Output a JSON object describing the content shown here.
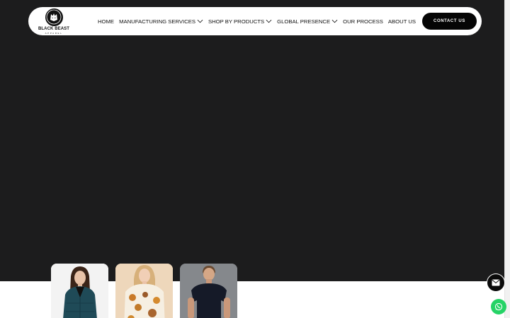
{
  "brand": {
    "name": "BLACK BEAST",
    "tagline": "APPAREL"
  },
  "nav": {
    "items": [
      {
        "label": "HOME",
        "has_dropdown": false
      },
      {
        "label": "MANUFACTURING SERVICES",
        "has_dropdown": true
      },
      {
        "label": "SHOP BY PRODUCTS",
        "has_dropdown": true
      },
      {
        "label": "GLOBAL PRESENCE",
        "has_dropdown": true
      },
      {
        "label": "OUR PROCESS",
        "has_dropdown": false
      },
      {
        "label": "ABOUT US",
        "has_dropdown": false
      }
    ],
    "contact_label": "CONTACT US"
  },
  "colors": {
    "hero_bg": "#1c1c1d",
    "button_bg": "#050505",
    "whatsapp": "#25d366"
  },
  "icons": {
    "logo": "wolf-icon",
    "dropdown": "chevron-down-icon",
    "email": "envelope-icon",
    "whatsapp": "whatsapp-icon"
  },
  "product_cards": [
    {
      "subject": "woman-teal-puffer-jacket"
    },
    {
      "subject": "girl-printed-dress"
    },
    {
      "subject": "man-navy-tshirt"
    }
  ]
}
